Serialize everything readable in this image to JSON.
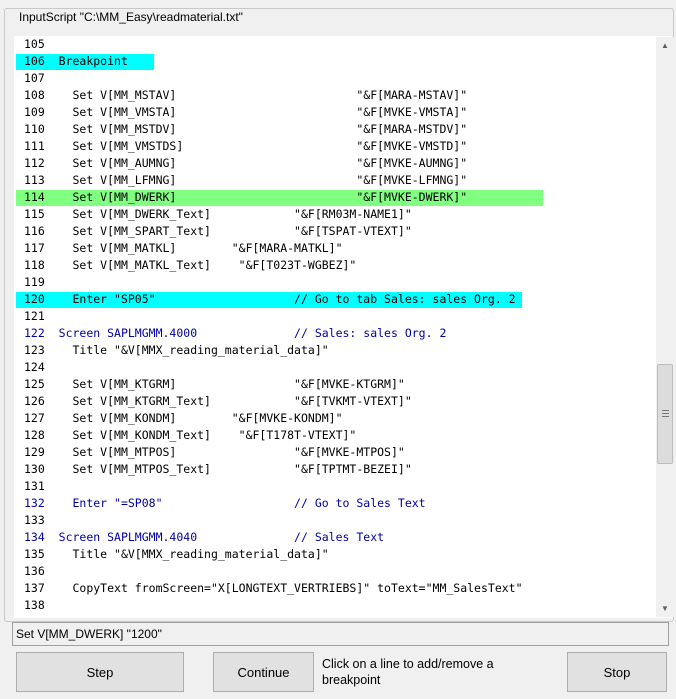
{
  "groupbox_title": "InputScript \"C:\\MM_Easy\\readmaterial.txt\"",
  "colors": {
    "breakpoint": "#00ffff",
    "current_line": "#80ff80",
    "code_blue": "#0000a0",
    "code_black": "#000000"
  },
  "lines": [
    {
      "num": "105",
      "text": "",
      "style": "black",
      "hl": ""
    },
    {
      "num": "106",
      "text": "Breakpoint",
      "style": "black",
      "hl": "breakpoint"
    },
    {
      "num": "107",
      "text": "",
      "style": "black",
      "hl": ""
    },
    {
      "num": "108",
      "text": "  Set V[MM_MSTAV]                          \"&F[MARA-MSTAV]\"",
      "style": "black",
      "hl": ""
    },
    {
      "num": "109",
      "text": "  Set V[MM_VMSTA]                          \"&F[MVKE-VMSTA]\"",
      "style": "black",
      "hl": ""
    },
    {
      "num": "110",
      "text": "  Set V[MM_MSTDV]                          \"&F[MARA-MSTDV]\"",
      "style": "black",
      "hl": ""
    },
    {
      "num": "111",
      "text": "  Set V[MM_VMSTDS]                         \"&F[MVKE-VMSTD]\"",
      "style": "black",
      "hl": ""
    },
    {
      "num": "112",
      "text": "  Set V[MM_AUMNG]                          \"&F[MVKE-AUMNG]\"",
      "style": "black",
      "hl": ""
    },
    {
      "num": "113",
      "text": "  Set V[MM_LFMNG]                          \"&F[MVKE-LFMNG]\"",
      "style": "black",
      "hl": ""
    },
    {
      "num": "114",
      "text": "  Set V[MM_DWERK]                          \"&F[MVKE-DWERK]\"",
      "style": "black",
      "hl": "current"
    },
    {
      "num": "115",
      "text": "  Set V[MM_DWERK_Text]            \"&F[RM03M-NAME1]\"",
      "style": "black",
      "hl": ""
    },
    {
      "num": "116",
      "text": "  Set V[MM_SPART_Text]            \"&F[TSPAT-VTEXT]\"",
      "style": "black",
      "hl": ""
    },
    {
      "num": "117",
      "text": "  Set V[MM_MATKL]        \"&F[MARA-MATKL]\"",
      "style": "black",
      "hl": ""
    },
    {
      "num": "118",
      "text": "  Set V[MM_MATKL_Text]    \"&F[T023T-WGBEZ]\"",
      "style": "black",
      "hl": ""
    },
    {
      "num": "119",
      "text": "",
      "style": "black",
      "hl": ""
    },
    {
      "num": "120",
      "text": "  Enter \"SP05\"                    // Go to tab Sales: sales Org. 2",
      "style": "black",
      "hl": "breakpoint"
    },
    {
      "num": "121",
      "text": "",
      "style": "black",
      "hl": ""
    },
    {
      "num": "122",
      "text": "Screen SAPLMGMM.4000              // Sales: sales Org. 2",
      "style": "blue",
      "hl": ""
    },
    {
      "num": "123",
      "text": "  Title \"&V[MMX_reading_material_data]\"",
      "style": "black",
      "hl": ""
    },
    {
      "num": "124",
      "text": "",
      "style": "black",
      "hl": ""
    },
    {
      "num": "125",
      "text": "  Set V[MM_KTGRM]                 \"&F[MVKE-KTGRM]\"",
      "style": "black",
      "hl": ""
    },
    {
      "num": "126",
      "text": "  Set V[MM_KTGRM_Text]            \"&F[TVKMT-VTEXT]\"",
      "style": "black",
      "hl": ""
    },
    {
      "num": "127",
      "text": "  Set V[MM_KONDM]        \"&F[MVKE-KONDM]\"",
      "style": "black",
      "hl": ""
    },
    {
      "num": "128",
      "text": "  Set V[MM_KONDM_Text]    \"&F[T178T-VTEXT]\"",
      "style": "black",
      "hl": ""
    },
    {
      "num": "129",
      "text": "  Set V[MM_MTPOS]                 \"&F[MVKE-MTPOS]\"",
      "style": "black",
      "hl": ""
    },
    {
      "num": "130",
      "text": "  Set V[MM_MTPOS_Text]            \"&F[TPTMT-BEZEI]\"",
      "style": "black",
      "hl": ""
    },
    {
      "num": "131",
      "text": "",
      "style": "black",
      "hl": ""
    },
    {
      "num": "132",
      "text": "  Enter \"=SP08\"                   // Go to Sales Text",
      "style": "blue",
      "hl": ""
    },
    {
      "num": "133",
      "text": "",
      "style": "black",
      "hl": ""
    },
    {
      "num": "134",
      "text": "Screen SAPLMGMM.4040              // Sales Text",
      "style": "blue",
      "hl": ""
    },
    {
      "num": "135",
      "text": "  Title \"&V[MMX_reading_material_data]\"",
      "style": "black",
      "hl": ""
    },
    {
      "num": "136",
      "text": "",
      "style": "black",
      "hl": ""
    },
    {
      "num": "137",
      "text": "  CopyText fromScreen=\"X[LONGTEXT_VERTRIEBS]\" toText=\"MM_SalesText\"",
      "style": "black",
      "hl": ""
    },
    {
      "num": "138",
      "text": "",
      "style": "black",
      "hl": ""
    }
  ],
  "scrollbar": {
    "up_icon": "scroll-up-arrow",
    "down_icon": "scroll-down-arrow"
  },
  "status_text": "Set V[MM_DWERK] \"1200\"",
  "buttons": {
    "step": "Step",
    "continue": "Continue",
    "stop": "Stop"
  },
  "hint_text": "Click on a line to add/remove a breakpoint"
}
